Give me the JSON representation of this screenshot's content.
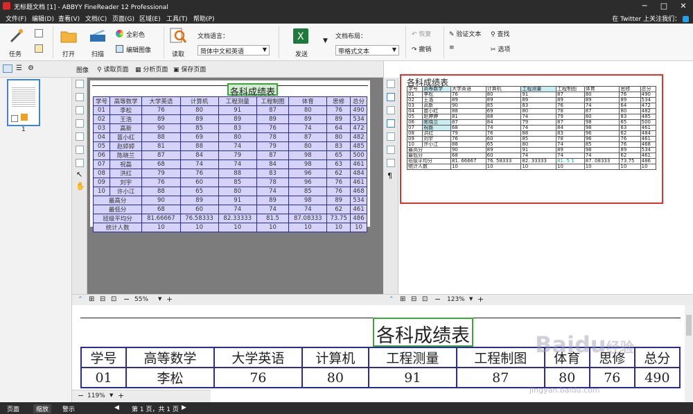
{
  "window": {
    "title": "无标题文档 [1] - ABBYY FineReader 12 Professional",
    "min": "─",
    "max": "□",
    "close": "✕"
  },
  "menu": {
    "items": [
      "文件(F)",
      "编辑(D)",
      "查看(V)",
      "文档(C)",
      "页面(G)",
      "区域(E)",
      "工具(T)",
      "帮助(P)"
    ],
    "twitter": "在 Twitter 上关注我们："
  },
  "ribbon": {
    "task": "任务",
    "open": "打开",
    "scan": "扫描",
    "color_mode": "全彩色",
    "edit_image": "编辑图像",
    "read": "读取",
    "doc_lang_label": "文档语言：",
    "doc_lang_value": "简体中文和英语",
    "send": "发送",
    "doc_layout_label": "文档布局：",
    "doc_layout_value": "带格式文本",
    "undo": "恢复",
    "redo": "撤销",
    "verify_text": "验证文本",
    "find": "查找",
    "options": "选项"
  },
  "image_pane": {
    "header": "图像",
    "read_page": "读取页面",
    "analyze_page": "分析页面",
    "save_page": "保存页面",
    "zoom": "55%"
  },
  "text_pane": {
    "zoom": "123%"
  },
  "zoom_pane": {
    "zoom": "119%"
  },
  "thumbnails": {
    "page_number": "1"
  },
  "status": {
    "tabs": [
      "页面",
      "缩放",
      "警示"
    ],
    "page_info": "第 1 页，共 1 页"
  },
  "colors": {
    "accent": "#2c2c2c",
    "region_border": "#2a2a9a",
    "region_fill": "#d6d3fb",
    "title_region": "#3aa53a",
    "highlight": "#e03030"
  },
  "sheet": {
    "title": "各科成绩表",
    "headers": [
      "学号",
      "高等数学",
      "大学英语",
      "计算机",
      "工程测量",
      "工程制图",
      "体育",
      "思修",
      "总分"
    ],
    "rows": [
      [
        "01",
        "李松",
        "76",
        "80",
        "91",
        "87",
        "80",
        "76",
        "490"
      ],
      [
        "02",
        "王浩",
        "89",
        "89",
        "89",
        "89",
        "89",
        "89",
        "534"
      ],
      [
        "03",
        "高新",
        "90",
        "85",
        "83",
        "76",
        "74",
        "64",
        "472"
      ],
      [
        "04",
        "苗小红",
        "88",
        "69",
        "80",
        "78",
        "87",
        "80",
        "482"
      ],
      [
        "05",
        "赵婷婷",
        "81",
        "88",
        "74",
        "79",
        "80",
        "83",
        "485"
      ],
      [
        "06",
        "陈晓兰",
        "87",
        "84",
        "79",
        "87",
        "98",
        "65",
        "500"
      ],
      [
        "07",
        "祝磊",
        "68",
        "74",
        "74",
        "84",
        "98",
        "63",
        "461"
      ],
      [
        "08",
        "洪红",
        "79",
        "76",
        "88",
        "83",
        "96",
        "62",
        "484"
      ],
      [
        "09",
        "刘宇",
        "76",
        "60",
        "85",
        "78",
        "96",
        "76",
        "461"
      ],
      [
        "10",
        "许小江",
        "88",
        "65",
        "80",
        "74",
        "85",
        "76",
        "468"
      ]
    ],
    "max_label": "最高分",
    "max": [
      "90",
      "89",
      "91",
      "89",
      "98",
      "89",
      "534"
    ],
    "min_label": "最低分",
    "min": [
      "68",
      "60",
      "74",
      "74",
      "74",
      "62",
      "461"
    ],
    "avg_label": "班级平均分",
    "avg": [
      "81.66667",
      "76.58333",
      "82.33333",
      "81.5",
      "87.08333",
      "73.75",
      "486"
    ],
    "count_label": "统计人数",
    "count": [
      "10",
      "10",
      "10",
      "10",
      "10",
      "10",
      "10"
    ]
  },
  "text_sheet": {
    "title": "各科成绩表",
    "headers": [
      "学号",
      "高等数学",
      "大学英语",
      "计算机",
      "工程测量",
      "工程制图",
      "体育",
      "思修",
      "总分"
    ],
    "rows": [
      [
        "01",
        "李松",
        "76",
        "80",
        "91",
        "87",
        "80",
        "76",
        "490"
      ],
      [
        "02",
        "王浩",
        "89",
        "89",
        "89",
        "89",
        "89",
        "89",
        "534"
      ],
      [
        "03",
        "高新",
        "90",
        "85",
        "83",
        "76",
        "74",
        "64",
        "472"
      ],
      [
        "04",
        "苗小红",
        "88",
        "69",
        "80",
        "78",
        "87",
        "80",
        "482"
      ],
      [
        "05",
        "赵婷婷",
        "81",
        "88",
        "74",
        "79",
        "80",
        "83",
        "485"
      ],
      [
        "06",
        "陈晓兰",
        "87",
        "84",
        "79",
        "87",
        "98",
        "65",
        "500"
      ],
      [
        "07",
        "祝磊",
        "68",
        "74",
        "74",
        "84",
        "98",
        "63",
        "461"
      ],
      [
        "08",
        "洪红",
        "79",
        "76",
        "88",
        "83",
        "96",
        "62",
        "484"
      ],
      [
        "09",
        "刘宇",
        "76",
        "60",
        "85",
        "78",
        "96",
        "76",
        "461"
      ],
      [
        "10",
        "许小江",
        "88",
        "65",
        "80",
        "74",
        "85",
        "76",
        "468"
      ],
      [
        "最高分",
        "",
        "90",
        "89",
        "91",
        "89",
        "98",
        "89",
        "534"
      ],
      [
        "最低分",
        "",
        "68",
        "60",
        "74",
        "74",
        "74",
        "62",
        "461"
      ],
      [
        "班级平均分",
        "",
        "81. 66667",
        "76. 58333",
        "82. 33333",
        "81. 5 1",
        "87. 08333",
        "73.75",
        "486"
      ],
      [
        "统计人数",
        "",
        "10",
        "10",
        "10",
        "10",
        "10",
        "10",
        "10"
      ]
    ]
  },
  "watermark": {
    "brand": "Baidu",
    "sub": "经验",
    "url": "jingyan.baidu.com"
  }
}
